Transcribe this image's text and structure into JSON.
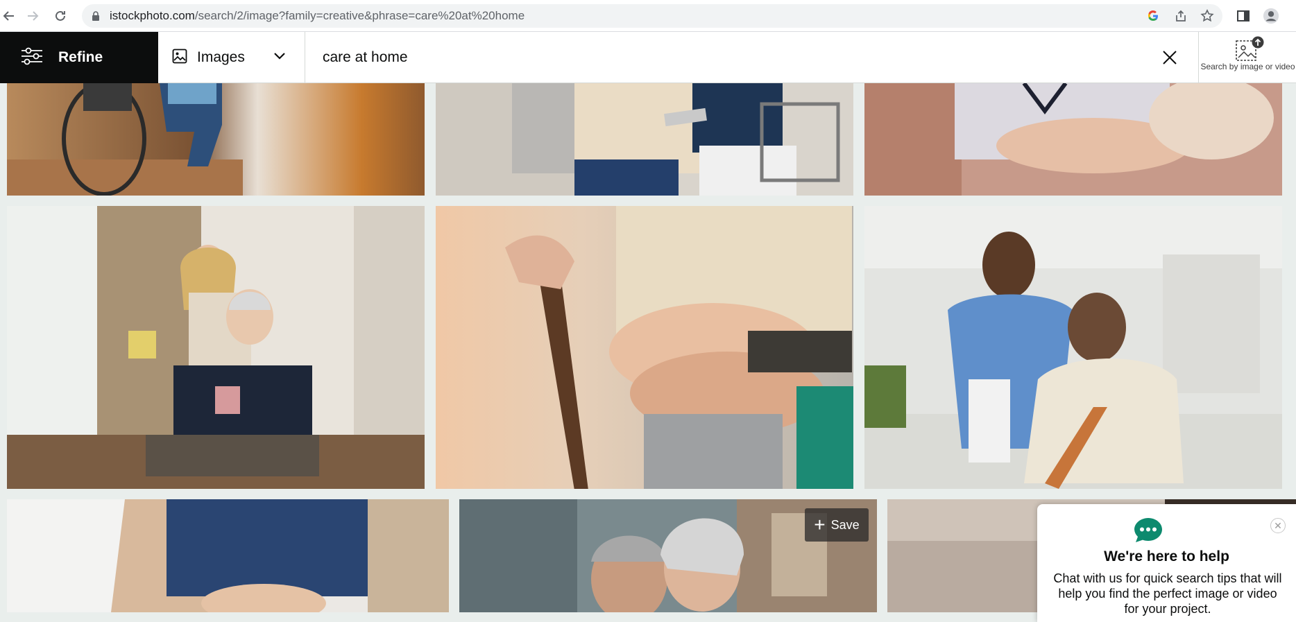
{
  "browser": {
    "url_host": "istockphoto.com",
    "url_path": "/search/2/image?family=creative&phrase=care%20at%20home"
  },
  "header": {
    "refine_label": "Refine",
    "type_label": "Images",
    "search_query": "care at home",
    "search_by_image_label": "Search by image or video"
  },
  "overlay": {
    "save_label": "Save"
  },
  "chat": {
    "title": "We're here to help",
    "body": "Chat with us for quick search tips that will help you find the perfect image or video for your project."
  },
  "colors": {
    "accent_teal": "#0d8a6e",
    "dark": "#0c0d0d"
  }
}
